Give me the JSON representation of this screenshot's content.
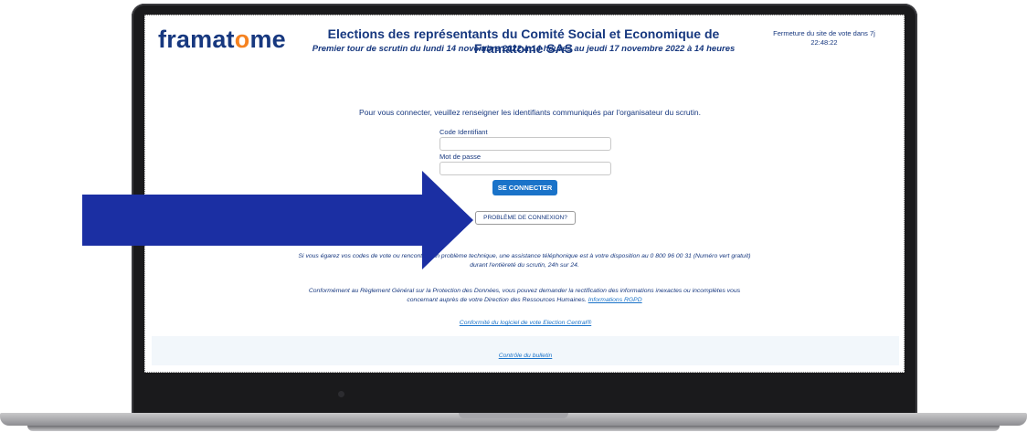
{
  "header": {
    "logo_text_before": "framat",
    "logo_text_o": "o",
    "logo_text_after": "me",
    "title": "Elections des représentants du Comité Social et Economique de Framatome SAS",
    "subtitle": "Premier tour de scrutin du lundi 14 novembre 2022 à 14 heures au jeudi 17 novembre 2022 à 14 heures",
    "closing_label": "Fermeture du site de vote dans 7j",
    "closing_time": "22:48:22"
  },
  "login": {
    "intro": "Pour vous connecter, veuillez renseigner les identifiants communiqués par l'organisateur du scrutin.",
    "id_label": "Code Identifiant",
    "id_value": "",
    "password_label": "Mot de passe",
    "password_value": "",
    "connect_button": "SE CONNECTER",
    "problem_button": "PROBLÈME DE CONNEXION?"
  },
  "info": {
    "assistance_part1": "Si vous égarez vos codes de vote ou rencontrez un problème technique, une assistance téléphonique est à votre disposition au 0 800 96 00 31 (Numéro vert gratuit)",
    "assistance_part2": "durant l'entièreté du scrutin, 24h sur 24.",
    "rgpd_part1": "Conformément au Règlement Général sur la Protection des Données, vous pouvez demander la rectification des informations inexactes ou incomplètes vous",
    "rgpd_part2": "concernant auprès de votre Direction des Ressources Humaines.",
    "rgpd_link": "Informations RGPD",
    "conformity_link": "Conformité du logiciel de vote Election Central®",
    "ballot_link": "Contrôle du bulletin"
  },
  "colors": {
    "brand_navy": "#17387f",
    "brand_orange": "#f58220",
    "button_blue": "#1a73c9",
    "arrow": "#1b2fa3"
  },
  "icons": {
    "arrow": "arrow-right-icon"
  }
}
